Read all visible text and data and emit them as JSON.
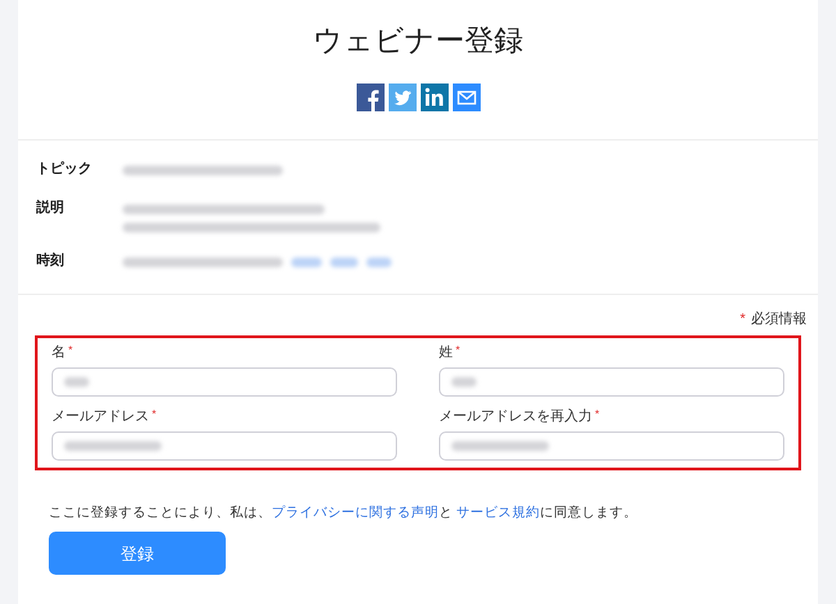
{
  "title": "ウェビナー登録",
  "share_icons": [
    {
      "kind": "facebook"
    },
    {
      "kind": "twitter"
    },
    {
      "kind": "linkedin"
    },
    {
      "kind": "email"
    }
  ],
  "details": [
    {
      "label": "トピック"
    },
    {
      "label": "説明"
    },
    {
      "label": "時刻"
    }
  ],
  "required_note": {
    "mark": "*",
    "text": "必須情報"
  },
  "fields": [
    {
      "label": "名",
      "mark": "*"
    },
    {
      "label": "姓",
      "mark": "*"
    },
    {
      "label": "メールアドレス",
      "mark": "*"
    },
    {
      "label": "メールアドレスを再入力",
      "mark": "*"
    }
  ],
  "consent": [
    {
      "kind": "text",
      "text": "ここに登録することにより、私は、"
    },
    {
      "kind": "link",
      "text": "プライバシーに関する声明"
    },
    {
      "kind": "text",
      "text": "と "
    },
    {
      "kind": "link",
      "text": "サービス規約"
    },
    {
      "kind": "text",
      "text": "に同意します。"
    }
  ],
  "submit": "登録"
}
